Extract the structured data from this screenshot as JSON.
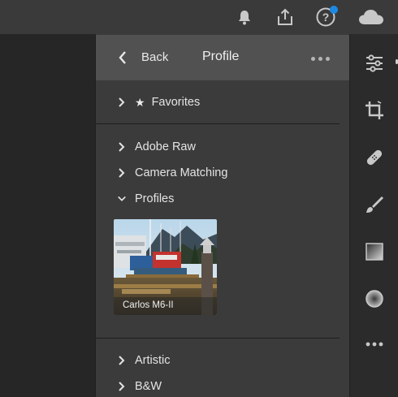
{
  "topbar": {
    "icons": [
      "bell-icon",
      "share-icon",
      "help-icon",
      "cloud-icon"
    ],
    "notification_color": "#1e88e5"
  },
  "panel": {
    "back_label": "Back",
    "title": "Profile",
    "more_icon": "more-horizontal-icon",
    "favorites_label": "Favorites",
    "groups": [
      "Adobe Raw",
      "Camera Matching",
      "Profiles"
    ],
    "expanded_group": "Profiles",
    "profile_thumbnail": {
      "label": "Carlos M6-II"
    },
    "lower_groups": [
      "Artistic",
      "B&W"
    ]
  },
  "toolbar": {
    "tools": [
      "sliders-icon",
      "crop-icon",
      "healing-bandage-icon",
      "brush-icon",
      "linear-gradient-icon",
      "radial-gradient-icon",
      "more-horizontal-icon"
    ]
  },
  "colors": {
    "topbar_bg": "#3a3a3a",
    "panel_bg": "#3b3b3b",
    "panel_header_bg": "#515151",
    "icon_color": "#c8c8c8"
  }
}
